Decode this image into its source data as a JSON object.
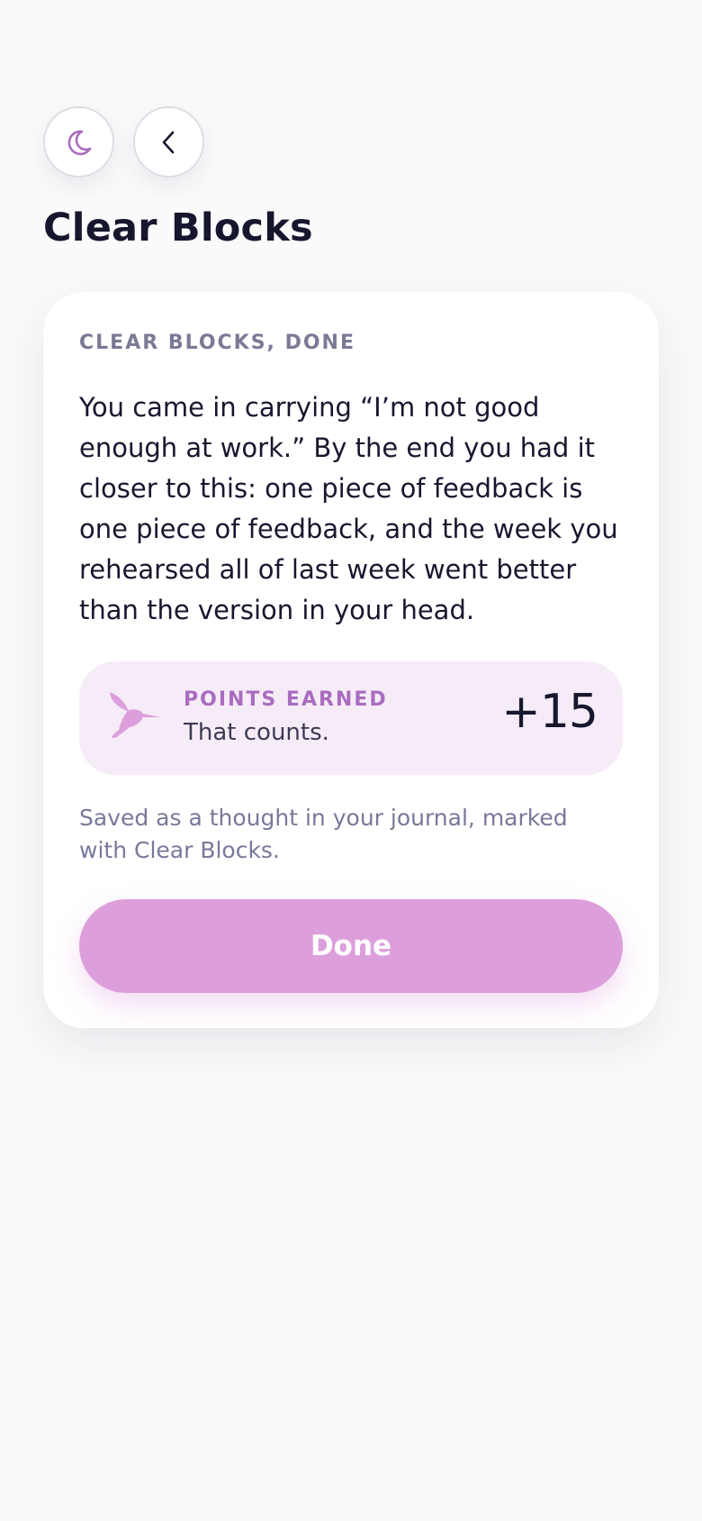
{
  "header": {
    "title": "Clear Blocks",
    "theme_icon": "moon-icon",
    "back_icon": "chevron-left-icon"
  },
  "card": {
    "eyebrow": "CLEAR BLOCKS, DONE",
    "summary": "You came in carrying “I’m not good enough at work.” By the end you had it closer to this: one piece of feedback is one piece of feedback, and the week you rehearsed all of last week went better than the version in your head.",
    "points": {
      "icon": "hummingbird-icon",
      "label": "POINTS EARNED",
      "subtitle": "That counts.",
      "value": "+15"
    },
    "saved_note": "Saved as a thought in your journal, marked with Clear Blocks.",
    "done_label": "Done"
  },
  "colors": {
    "background": "#fafafb",
    "accent": "#dd9fdc",
    "accent_text": "#a96cc0",
    "points_bg": "#f6ecf7"
  }
}
